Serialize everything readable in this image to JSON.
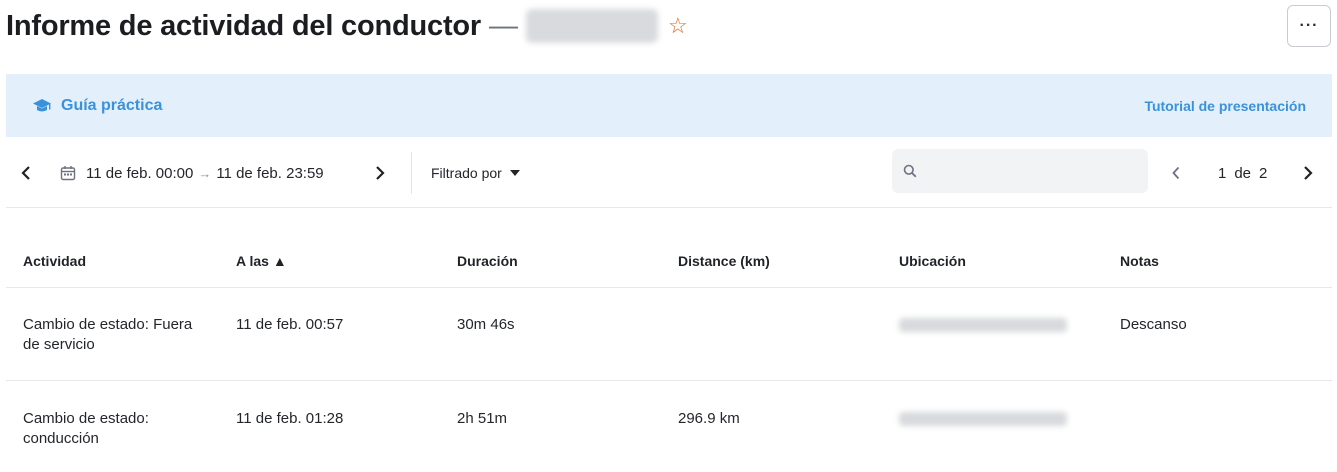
{
  "header": {
    "title": "Informe de actividad del conductor",
    "separator": "—",
    "more_label": "···"
  },
  "banner": {
    "guide_label": "Guía práctica",
    "tutorial_label": "Tutorial de presentación"
  },
  "toolbar": {
    "date_start": "11 de feb. 00:00",
    "date_arrow": "→",
    "date_end": "11 de feb. 23:59",
    "filter_label": "Filtrado por",
    "search_placeholder": "",
    "page_current": "1",
    "page_of": "de",
    "page_total": "2"
  },
  "table": {
    "columns": [
      "Actividad",
      "A las ▲",
      "Duración",
      "Distance (km)",
      "Ubicación",
      "Notas"
    ],
    "rows": [
      {
        "activity_line1": "Cambio de estado: Fuera",
        "activity_line2": "de servicio",
        "time": "11 de feb. 00:57",
        "duration": "30m 46s",
        "distance": "",
        "notes": "Descanso"
      },
      {
        "activity_line1": "Cambio de estado:",
        "activity_line2": "conducción",
        "time": "11 de feb. 01:28",
        "duration": "2h 51m",
        "distance": "296.9 km",
        "notes": ""
      }
    ]
  },
  "icons": {
    "favorite": "star-outline-icon",
    "guide": "graduation-cap-icon",
    "calendar": "calendar-icon",
    "search": "search-icon"
  },
  "colors": {
    "accent_blue": "#3a92db",
    "banner_bg": "#e3f0fc",
    "star_orange": "#e46a1c"
  }
}
